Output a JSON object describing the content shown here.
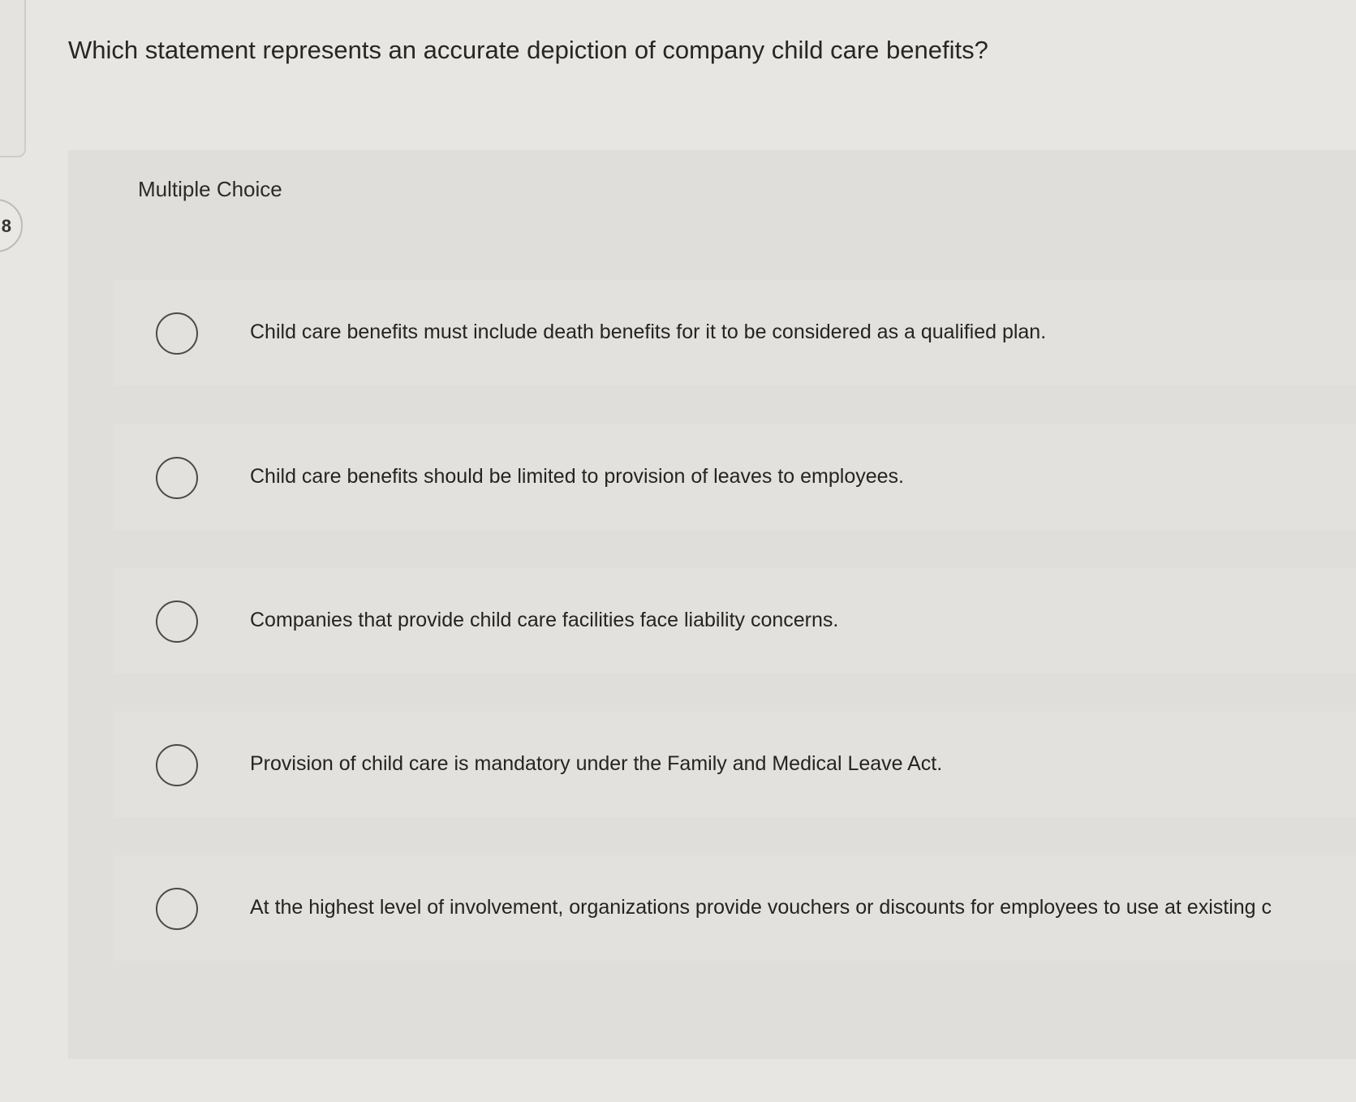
{
  "question": {
    "number": "8",
    "text": "Which statement represents an accurate depiction of company child care benefits?"
  },
  "choices": {
    "type_label": "Multiple Choice",
    "options": [
      {
        "label": "Child care benefits must include death benefits for it to be considered as a qualified plan."
      },
      {
        "label": "Child care benefits should be limited to provision of leaves to employees."
      },
      {
        "label": "Companies that provide child care facilities face liability concerns."
      },
      {
        "label": "Provision of child care is mandatory under the Family and Medical Leave Act."
      },
      {
        "label": "At the highest level of involvement, organizations provide vouchers or discounts for employees to use at existing c"
      }
    ]
  }
}
